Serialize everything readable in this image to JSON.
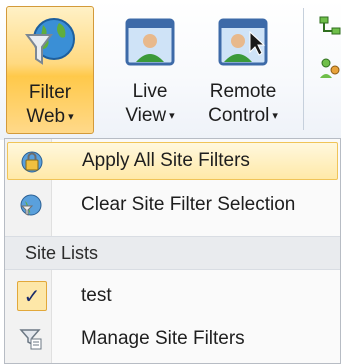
{
  "ribbon": {
    "filter_web": {
      "line1": "Filter",
      "line2": "Web",
      "icon": "globe-funnel-icon"
    },
    "live_view": {
      "line1": "Live",
      "line2": "View",
      "icon": "live-view-icon"
    },
    "remote_control": {
      "line1": "Remote",
      "line2": "Control",
      "icon": "remote-control-icon"
    },
    "dropdown_arrow": "▾"
  },
  "menu": {
    "items": [
      {
        "label": "Apply All Site Filters",
        "icon": "lock-globe-icon"
      },
      {
        "label": "Clear Site Filter Selection",
        "icon": "globe-clear-icon"
      }
    ],
    "section_header": "Site Lists",
    "site_lists": [
      {
        "label": "test",
        "checked": true,
        "check_glyph": "✓"
      }
    ],
    "manage": {
      "label": "Manage Site Filters",
      "icon": "funnel-list-icon"
    }
  },
  "colors": {
    "hover_bg": "#ffe9a8",
    "pressed_bg": "#ffd980",
    "accent_border": "#d39a3a"
  }
}
